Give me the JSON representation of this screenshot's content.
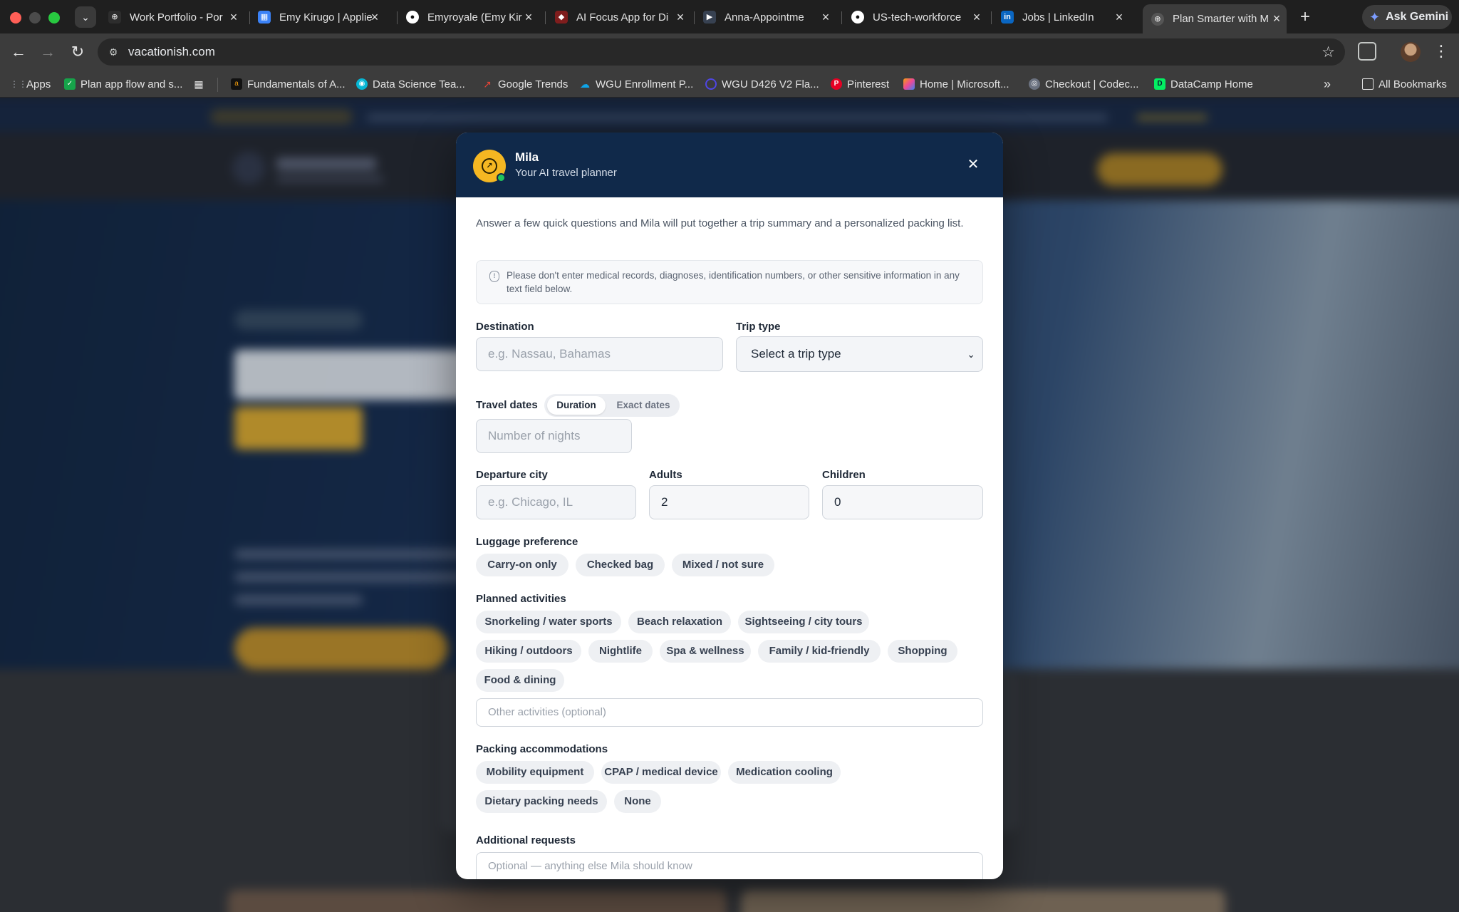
{
  "browser": {
    "tabs": [
      {
        "title": "Work Portfolio - Por",
        "fav": "⊕",
        "color": "#ffffff"
      },
      {
        "title": "Emy Kirugo | Applie",
        "fav": "▦",
        "color": "#3b82f6"
      },
      {
        "title": "Emyroyale (Emy Kir",
        "fav": "●",
        "color": "#ffffff"
      },
      {
        "title": "AI Focus App for Di",
        "fav": "◆",
        "color": "#ef4444"
      },
      {
        "title": "Anna-Appointme",
        "fav": "▶",
        "color": "#9ca3af"
      },
      {
        "title": "US-tech-workforce",
        "fav": "●",
        "color": "#ffffff"
      },
      {
        "title": "Jobs | LinkedIn",
        "fav": "in",
        "color": "#0a66c2"
      },
      {
        "title": "Plan Smarter with M",
        "fav": "⊕",
        "color": "#9ca3af"
      }
    ],
    "ask_gemini": "Ask Gemini",
    "url": "vacationish.com",
    "bookmarks": [
      {
        "label": "Apps",
        "fav": "⋮⋮",
        "color": "#9aa0a6"
      },
      {
        "label": "Plan app flow and s...",
        "fav": "✓",
        "color": "#16a34a"
      },
      {
        "label": "Fundamentals of A...",
        "fav": "a",
        "color": "#111111"
      },
      {
        "label": "Data Science Tea...",
        "fav": "◉",
        "color": "#06b6d4"
      },
      {
        "label": "Google Trends",
        "fav": "↗",
        "color": "#ea4335"
      },
      {
        "label": "WGU Enrollment P...",
        "fav": "☁",
        "color": "#0ea5e9"
      },
      {
        "label": "WGU D426 V2 Fla...",
        "fav": "Q",
        "color": "#4f46e5"
      },
      {
        "label": "Pinterest",
        "fav": "P",
        "color": "#e60023"
      },
      {
        "label": "Home | Microsoft...",
        "fav": "◆",
        "color": "#f59e0b"
      },
      {
        "label": "Checkout | Codec...",
        "fav": "◎",
        "color": "#6b7280"
      },
      {
        "label": "DataCamp Home",
        "fav": "D",
        "color": "#03ef62"
      }
    ],
    "all_bookmarks": "All Bookmarks"
  },
  "modal": {
    "name": "Mila",
    "subtitle": "Your AI travel planner",
    "intro": "Answer a few quick questions and Mila will put together a trip summary and a personalized packing list.",
    "notice": "Please don't enter medical records, diagnoses, identification numbers, or other sensitive information in any text field below.",
    "destination": {
      "label": "Destination",
      "placeholder": "e.g. Nassau, Bahamas"
    },
    "trip_type": {
      "label": "Trip type",
      "value": "Select a trip type"
    },
    "travel_dates": {
      "label": "Travel dates",
      "options": [
        "Duration",
        "Exact dates"
      ],
      "selected": "Duration",
      "placeholder": "Number of nights"
    },
    "departure": {
      "label": "Departure city",
      "placeholder": "e.g. Chicago, IL"
    },
    "adults": {
      "label": "Adults",
      "value": "2"
    },
    "children": {
      "label": "Children",
      "value": "0"
    },
    "luggage": {
      "label": "Luggage preference",
      "options": [
        "Carry-on only",
        "Checked bag",
        "Mixed / not sure"
      ]
    },
    "activities": {
      "label": "Planned activities",
      "options": [
        "Snorkeling / water sports",
        "Beach relaxation",
        "Sightseeing / city tours",
        "Hiking / outdoors",
        "Nightlife",
        "Spa & wellness",
        "Family / kid-friendly",
        "Shopping",
        "Food & dining"
      ],
      "other_placeholder": "Other activities (optional)"
    },
    "accommodations": {
      "label": "Packing accommodations",
      "options": [
        "Mobility equipment",
        "CPAP / medical device",
        "Medication cooling",
        "Dietary packing needs",
        "None"
      ]
    },
    "additional": {
      "label": "Additional requests",
      "placeholder": "Optional — anything else Mila should know"
    }
  }
}
